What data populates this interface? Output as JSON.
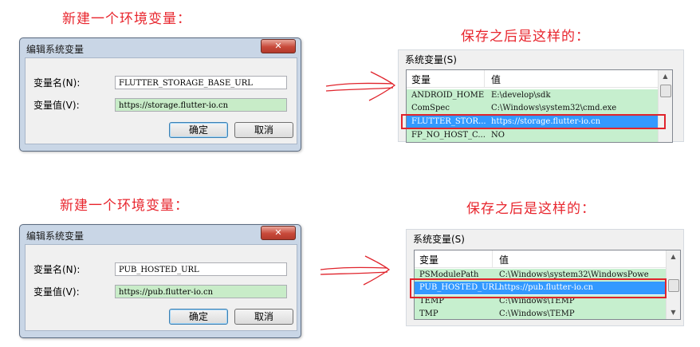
{
  "captions": {
    "new_var_1": "新建一个环境变量：",
    "saved_1": "保存之后是这样的：",
    "new_var_2": "新建一个环境变量：",
    "saved_2": "保存之后是这样的："
  },
  "dialog1": {
    "title": "编辑系统变量",
    "close_glyph": "✕",
    "name_label": "变量名(N):",
    "value_label": "变量值(V):",
    "name_value": "FLUTTER_STORAGE_BASE_URL",
    "value_value": "https://storage.flutter-io.cn",
    "ok_label": "确定",
    "cancel_label": "取消"
  },
  "dialog2": {
    "title": "编辑系统变量",
    "close_glyph": "✕",
    "name_label": "变量名(N):",
    "value_label": "变量值(V):",
    "name_value": "PUB_HOSTED_URL",
    "value_value": "https://pub.flutter-io.cn",
    "ok_label": "确定",
    "cancel_label": "取消"
  },
  "panel1": {
    "title": "系统变量(S)",
    "col_variable": "变量",
    "col_value": "值",
    "rows": [
      {
        "name": "ANDROID_HOME",
        "value": "E:\\develop\\sdk"
      },
      {
        "name": "ComSpec",
        "value": "C:\\Windows\\system32\\cmd.exe"
      },
      {
        "name": "FLUTTER_STOR...",
        "value": "https://storage.flutter-io.cn"
      },
      {
        "name": "FP_NO_HOST_C...",
        "value": "NO"
      }
    ]
  },
  "panel2": {
    "title": "系统变量(S)",
    "col_variable": "变量",
    "col_value": "值",
    "rows": [
      {
        "name": "PSModulePath",
        "value": "C:\\Windows\\system32\\WindowsPowe"
      },
      {
        "name": "PUB_HOSTED_URL",
        "value": "https://pub.flutter-io.cn"
      },
      {
        "name": "TEMP",
        "value": "C:\\Windows\\TEMP"
      },
      {
        "name": "TMP",
        "value": "C:\\Windows\\TEMP"
      }
    ]
  },
  "colors": {
    "caption": "#e8262e",
    "highlight_box": "#e0242c",
    "selected_row": "#3399ff",
    "row_bg": "#c6efce"
  }
}
